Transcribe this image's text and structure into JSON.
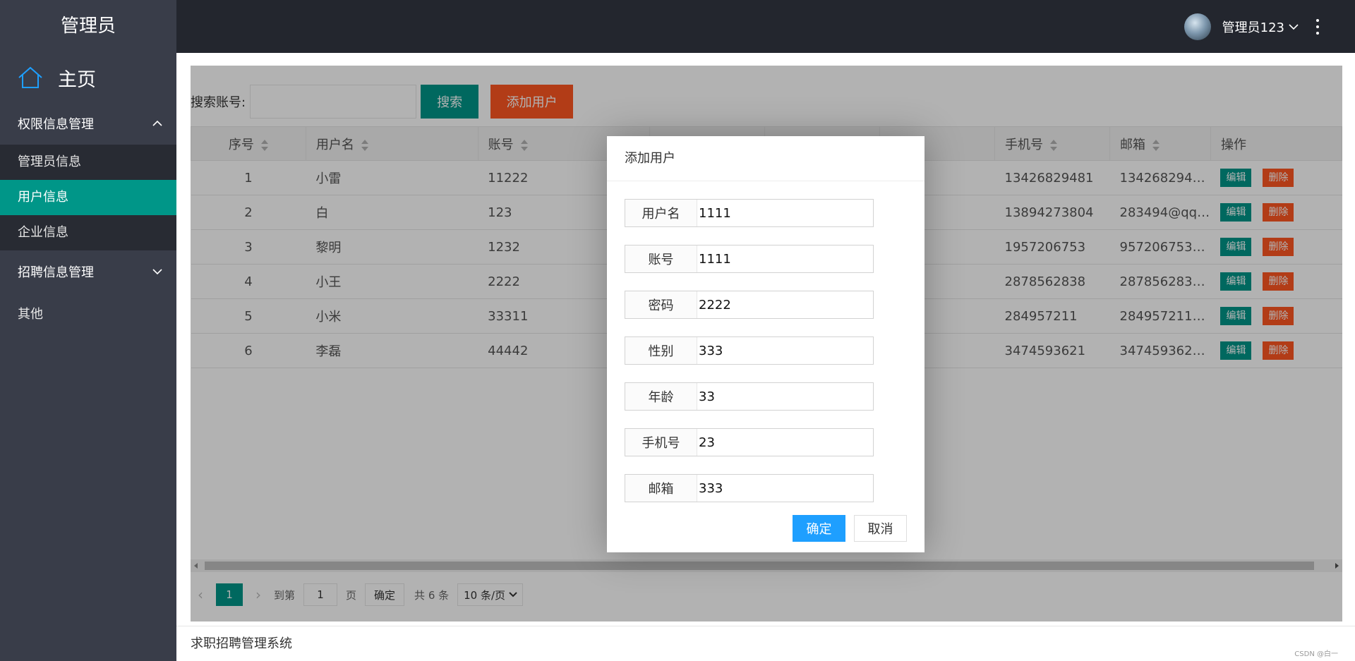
{
  "sidebar": {
    "logo": "管理员",
    "home": "主页",
    "groups": [
      {
        "label": "权限信息管理",
        "items": [
          "管理员信息",
          "用户信息",
          "企业信息"
        ]
      },
      {
        "label": "招聘信息管理"
      }
    ],
    "other": "其他",
    "active_item": "用户信息"
  },
  "header": {
    "username": "管理员123"
  },
  "toolbar": {
    "search_label": "搜索账号:",
    "search_placeholder": "",
    "search_button": "搜索",
    "add_button": "添加用户"
  },
  "table": {
    "columns": [
      "序号",
      "用户名",
      "账号",
      "",
      "",
      "",
      "手机号",
      "邮箱",
      "操作"
    ],
    "rows": [
      {
        "idx": "1",
        "username": "小雷",
        "account": "11222",
        "phone": "13426829481",
        "email": "1342682948…"
      },
      {
        "idx": "2",
        "username": "白",
        "account": "123",
        "phone": "13894273804",
        "email": "283494@qq.…"
      },
      {
        "idx": "3",
        "username": "黎明",
        "account": "1232",
        "phone": "1957206753",
        "email": "957206753@…"
      },
      {
        "idx": "4",
        "username": "小王",
        "account": "2222",
        "phone": "2878562838",
        "email": "2878562838…"
      },
      {
        "idx": "5",
        "username": "小米",
        "account": "33311",
        "phone": "284957211",
        "email": "284957211@…"
      },
      {
        "idx": "6",
        "username": "李磊",
        "account": "44442",
        "phone": "3474593621",
        "email": "3474593621…"
      }
    ],
    "edit_label": "编辑",
    "delete_label": "删除"
  },
  "pager": {
    "current_page": "1",
    "goto_label": "到第",
    "goto_value": "1",
    "page_unit": "页",
    "confirm": "确定",
    "total": "共 6 条",
    "page_size": "10 条/页"
  },
  "footer": {
    "text": "求职招聘管理系统",
    "watermark": "CSDN @白一"
  },
  "dialog": {
    "title": "添加用户",
    "fields": [
      {
        "label": "用户名",
        "value": "1111"
      },
      {
        "label": "账号",
        "value": "1111"
      },
      {
        "label": "密码",
        "value": "2222"
      },
      {
        "label": "性别",
        "value": "333"
      },
      {
        "label": "年龄",
        "value": "33"
      },
      {
        "label": "手机号",
        "value": "23"
      },
      {
        "label": "邮箱",
        "value": "333"
      }
    ],
    "ok": "确定",
    "cancel": "取消"
  },
  "colors": {
    "accent": "#009688",
    "danger": "#ff5722",
    "primary": "#1e9fff",
    "sidebar_bg": "#393d49",
    "header_bg": "#23262e"
  }
}
